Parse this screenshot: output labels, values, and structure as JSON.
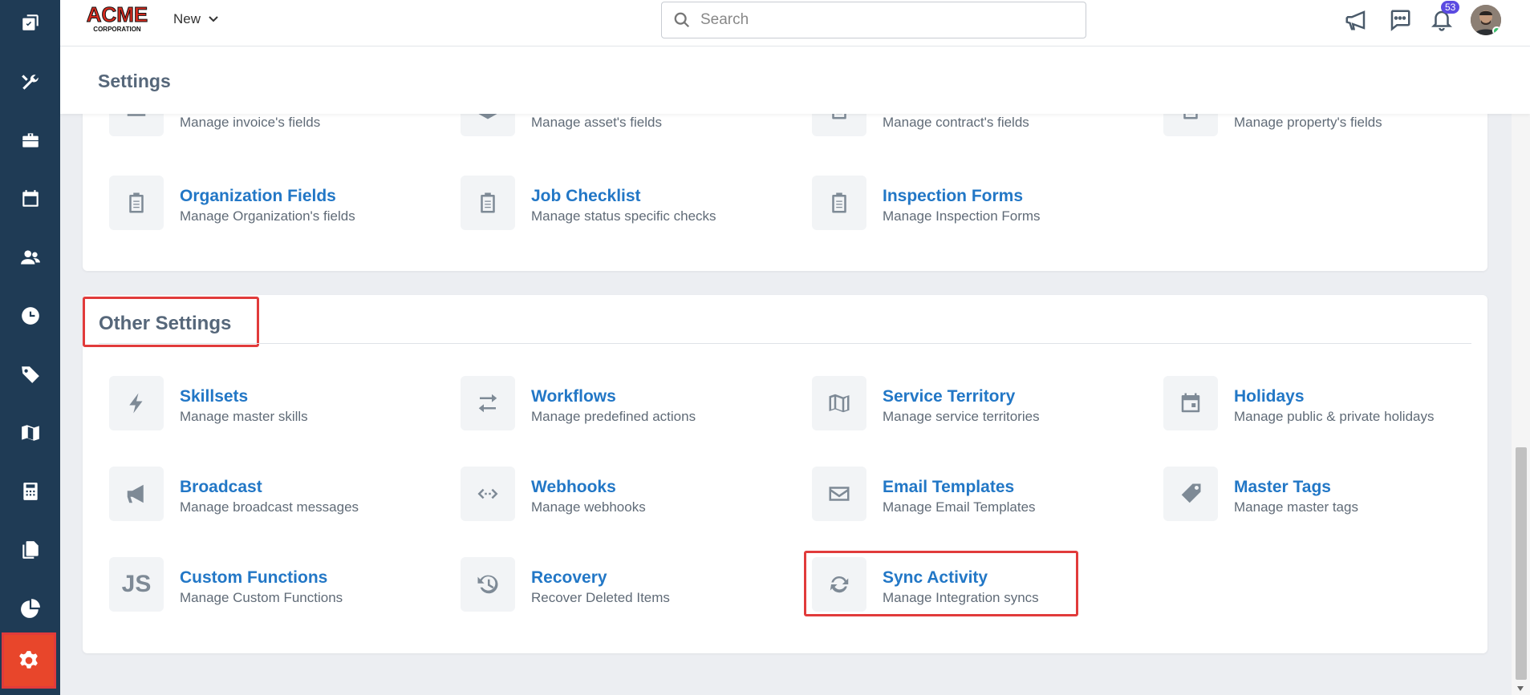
{
  "topbar": {
    "logo_top": "ACME",
    "logo_bottom": "CORPORATION",
    "new_label": "New",
    "search_placeholder": "Search",
    "notification_count": "53"
  },
  "page": {
    "title": "Settings"
  },
  "partial_row": [
    {
      "desc": "Manage invoice's fields",
      "icon": "list-icon"
    },
    {
      "desc": "Manage asset's fields",
      "icon": "cube-icon"
    },
    {
      "desc": "Manage contract's fields",
      "icon": "clipboard-icon"
    },
    {
      "desc": "Manage property's fields",
      "icon": "clipboard-icon"
    }
  ],
  "custom_fields": [
    {
      "title": "Organization Fields",
      "desc": "Manage Organization's fields"
    },
    {
      "title": "Job Checklist",
      "desc": "Manage status specific checks"
    },
    {
      "title": "Inspection Forms",
      "desc": "Manage Inspection Forms"
    }
  ],
  "other_settings": {
    "title": "Other Settings",
    "items": [
      {
        "title": "Skillsets",
        "desc": "Manage master skills",
        "icon": "bolt-icon"
      },
      {
        "title": "Workflows",
        "desc": "Manage predefined actions",
        "icon": "swap-arrows-icon"
      },
      {
        "title": "Service Territory",
        "desc": "Manage service territories",
        "icon": "map-icon"
      },
      {
        "title": "Holidays",
        "desc": "Manage public & private holidays",
        "icon": "calendar-icon"
      },
      {
        "title": "Broadcast",
        "desc": "Manage broadcast messages",
        "icon": "megaphone-icon"
      },
      {
        "title": "Webhooks",
        "desc": "Manage webhooks",
        "icon": "code-arrows-icon"
      },
      {
        "title": "Email Templates",
        "desc": "Manage Email Templates",
        "icon": "envelope-icon"
      },
      {
        "title": "Master Tags",
        "desc": "Manage master tags",
        "icon": "tag-icon"
      },
      {
        "title": "Custom Functions",
        "desc": "Manage Custom Functions",
        "icon": "js-icon",
        "icon_text": "JS"
      },
      {
        "title": "Recovery",
        "desc": "Recover Deleted Items",
        "icon": "history-icon"
      },
      {
        "title": "Sync Activity",
        "desc": "Manage Integration syncs",
        "icon": "sync-icon"
      }
    ]
  },
  "colors": {
    "accent": "#2277c6",
    "sidebar": "#1f3b55",
    "active": "#e8462b",
    "highlight": "#e13b3b"
  }
}
